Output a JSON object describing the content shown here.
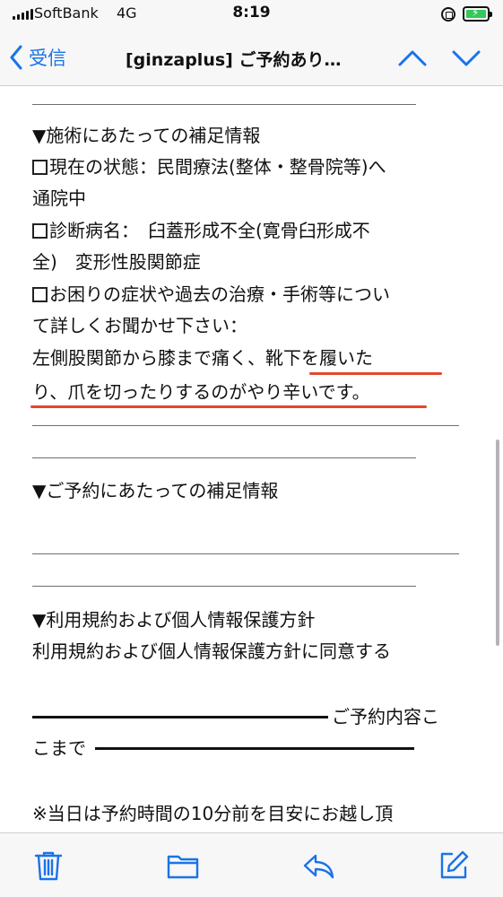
{
  "status_bar": {
    "carrier": "SoftBank",
    "network": "4G",
    "time": "8:19"
  },
  "nav": {
    "back_label": "受信",
    "title": "[ginzaplus] ご予約あり…"
  },
  "email": {
    "section1_heading": "▼施術にあたっての補足情報",
    "item1_line1": "現在の状態：民間療法(整体・整骨院等)へ",
    "item1_line2": "通院中",
    "item2_line1": "診断病名：　臼蓋形成不全(寛骨臼形成不",
    "item2_line2": "全)　変形性股関節症",
    "item3_line1": "お困りの症状や過去の治療・手術等につい",
    "item3_line2": "て詳しくお聞かせ下さい：",
    "answer_line1": "左側股関節から膝まで痛く、靴下を履いた",
    "answer_line2": "り、爪を切ったりするのがやり辛いです。",
    "section2_heading": "▼ご予約にあたっての補足情報",
    "section3_heading": "▼利用規約および個人情報保護方針",
    "agreement": "利用規約および個人情報保護方針に同意する",
    "end_marker_line1": "ご予約内容こ",
    "end_marker_line2": "こまで",
    "notice": "※当日は予約時間の10分前を目安にお越し頂"
  },
  "colors": {
    "accent": "#1a73e8",
    "highlight_underline": "#e2482b",
    "battery": "#34c759"
  },
  "icons": {
    "back": "chevron-left-icon",
    "prev": "chevron-up-icon",
    "next": "chevron-down-icon",
    "trash": "trash-icon",
    "folder": "folder-icon",
    "reply": "reply-icon",
    "compose": "compose-icon"
  }
}
